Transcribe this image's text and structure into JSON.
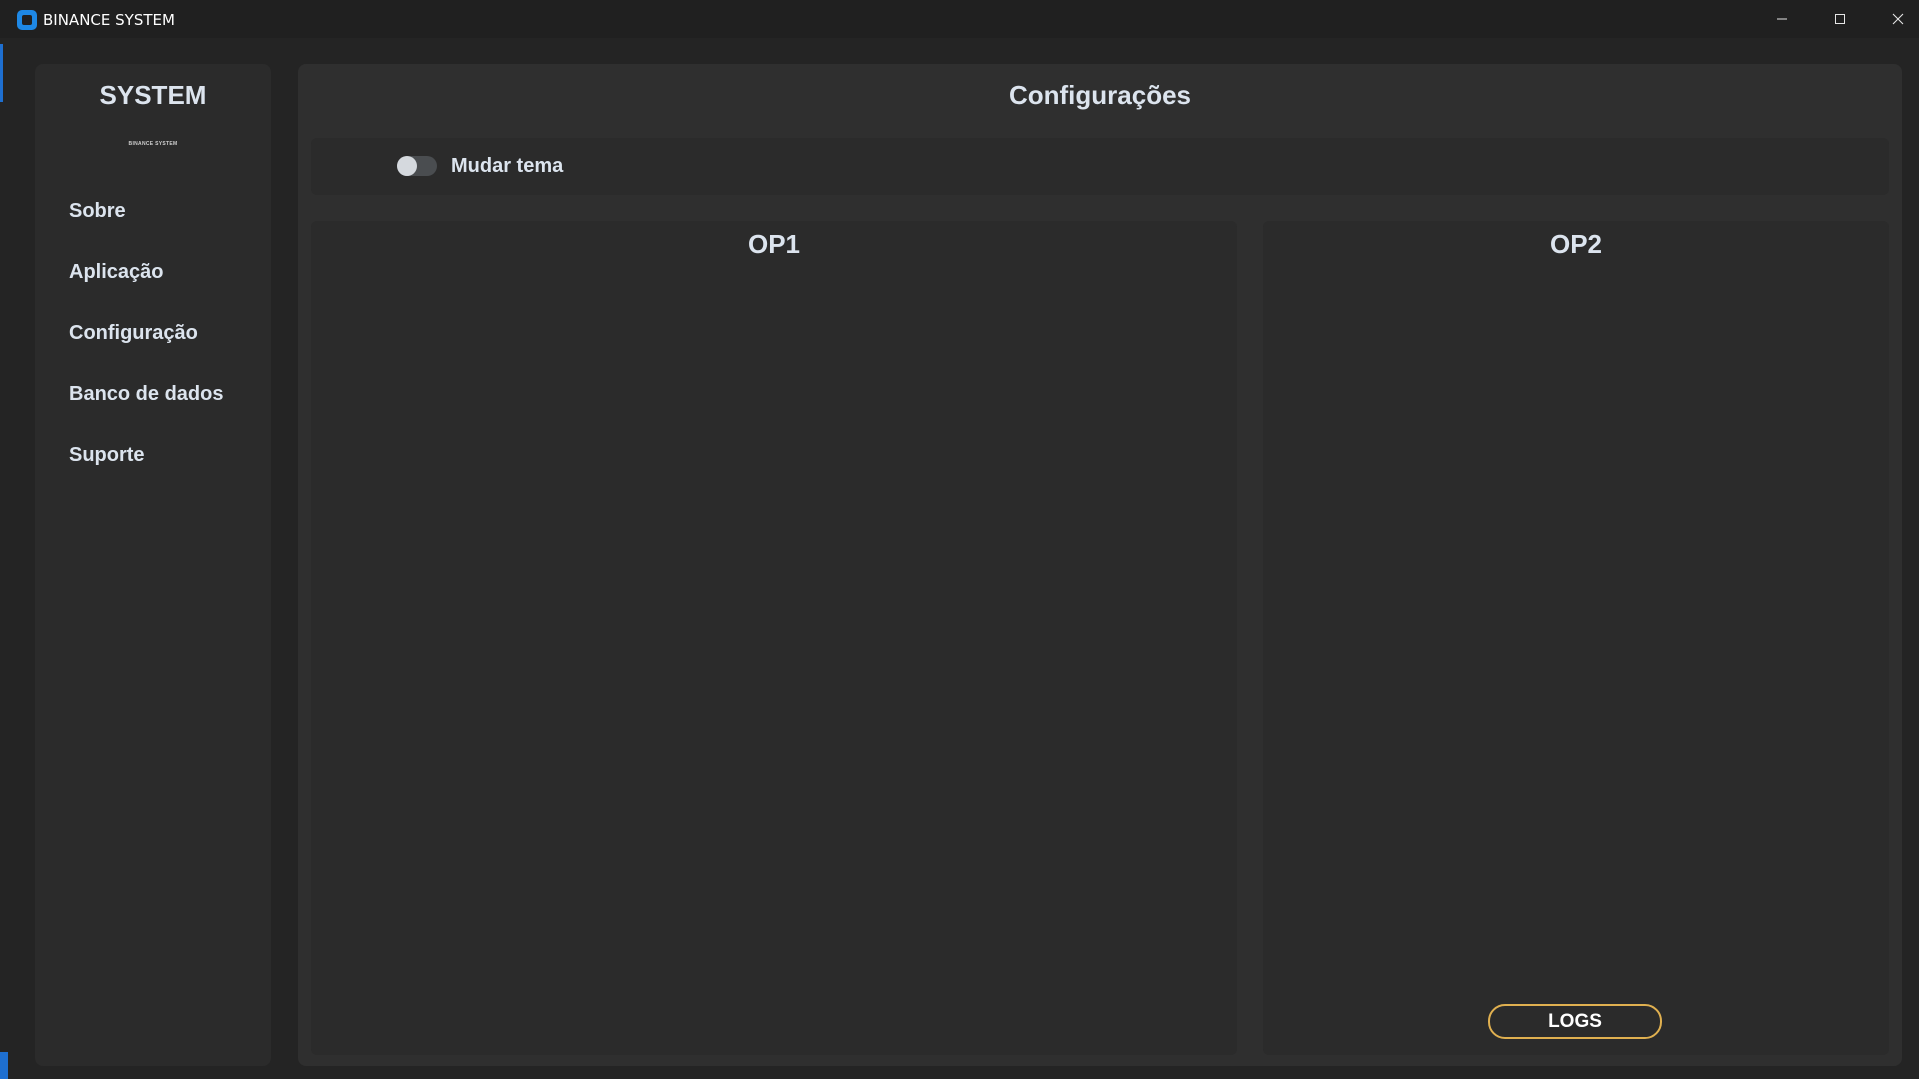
{
  "window": {
    "title": "BINANCE SYSTEM",
    "controls": {
      "minimize": "–",
      "maximize": "☐",
      "close": "✕"
    }
  },
  "sidebar": {
    "brand": "SYSTEM",
    "brand_sub": "BINANCE SYSTEM",
    "items": [
      {
        "label": "Sobre"
      },
      {
        "label": "Aplicação"
      },
      {
        "label": "Configuração"
      },
      {
        "label": "Banco de dados"
      },
      {
        "label": "Suporte"
      }
    ]
  },
  "main": {
    "title": "Configurações",
    "theme_toggle": {
      "label": "Mudar tema",
      "on": false
    },
    "panels": {
      "op1": {
        "title": "OP1"
      },
      "op2": {
        "title": "OP2",
        "button": "LOGS"
      }
    }
  },
  "colors": {
    "accent_blue": "#1e88e5",
    "logs_border": "#e0b050",
    "sidebar_bg": "#2b2b2b",
    "main_bg": "#2f2f2f",
    "text": "#dce4ee"
  },
  "icons": {
    "app": "app-icon",
    "minimize": "minimize-icon",
    "maximize": "maximize-icon",
    "close": "close-icon"
  }
}
